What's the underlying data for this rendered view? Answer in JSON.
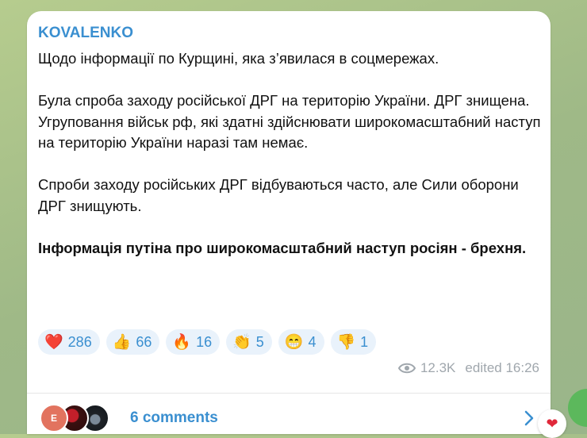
{
  "post": {
    "author": "KOVALENKO",
    "paragraphs": [
      "Щодо інформації по Курщині, яка з’явилася в соцмережах.",
      "Була спроба заходу російської ДРГ на територію України. ДРГ знищена. Угруповання військ рф, які здатні здійснювати широкомасштабний наступ на територію України наразі там немає.",
      "Спроби заходу російських ДРГ відбуваються часто, але Сили оборони ДРГ знищують."
    ],
    "bold_paragraph": "Інформація путіна про широкомасштабний наступ росіян - брехня.",
    "reactions": [
      {
        "emoji": "❤️",
        "name": "heart",
        "count": "286"
      },
      {
        "emoji": "👍",
        "name": "thumbs-up",
        "count": "66"
      },
      {
        "emoji": "🔥",
        "name": "fire",
        "count": "16"
      },
      {
        "emoji": "👏",
        "name": "clap",
        "count": "5"
      },
      {
        "emoji": "😁",
        "name": "grin",
        "count": "4"
      },
      {
        "emoji": "👎",
        "name": "thumbs-down",
        "count": "1"
      }
    ],
    "views": "12.3K",
    "edited": "edited 16:26",
    "comments": {
      "label": "6 comments",
      "first_avatar_letter": "E"
    }
  },
  "floating_reaction": "❤"
}
